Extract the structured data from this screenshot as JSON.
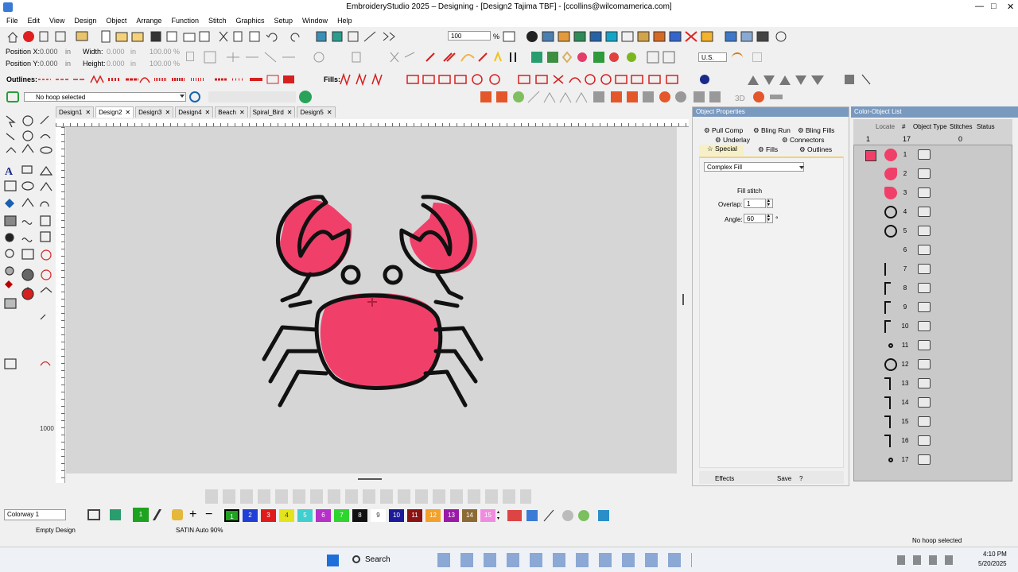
{
  "window": {
    "title": "EmbroideryStudio 2025 – Designing - [Design2     Tajima TBF] - [ccollins@wilcomamerica.com]",
    "min": "—",
    "max": "□",
    "close": "✕"
  },
  "menu": [
    "File",
    "Edit",
    "View",
    "Design",
    "Object",
    "Arrange",
    "Function",
    "Stitch",
    "Graphics",
    "Setup",
    "Window",
    "Help"
  ],
  "zoom": {
    "value": "100",
    "unit": "%"
  },
  "position": {
    "x_label": "Position X:",
    "x_value": "0.000",
    "y_label": "Position Y:",
    "y_value": "0.000",
    "unit": "in",
    "w_label": "Width:",
    "w_value": "0.000",
    "h_label": "Height:",
    "h_value": "0.000",
    "w_pct": "100.00",
    "h_pct": "100.00",
    "pct": "%"
  },
  "units": "U.S.",
  "outlines_label": "Outlines:",
  "fills_label": "Fills:",
  "hoop": "No hoop selected",
  "tabs": [
    "Design1",
    "Design2",
    "Design3",
    "Design4",
    "Beach",
    "Spiral_Bird",
    "Design5"
  ],
  "object_properties": {
    "title": "Object Properties",
    "tabs_row1": [
      "Pull Comp",
      "Bling Run",
      "Bling Fills"
    ],
    "tabs_row2": [
      "Underlay",
      "Connectors"
    ],
    "tabs_row3": [
      "Special",
      "Fills",
      "Outlines"
    ],
    "fill_type": "Complex Fill",
    "section": "Fill stitch",
    "overlap_label": "Overlap:",
    "overlap": "1",
    "angle_label": "Angle:",
    "angle": "60",
    "angle_unit": "°",
    "effects": "Effects",
    "save": "Save",
    "help": "?"
  },
  "color_list": {
    "title": "Color-Object List",
    "headers": [
      "Locate",
      "#",
      "Object Type",
      "Stitches",
      "Status"
    ],
    "summary": {
      "first": "1",
      "count": "17",
      "stitches": "0"
    },
    "items": [
      "1",
      "2",
      "3",
      "4",
      "5",
      "6",
      "7",
      "8",
      "9",
      "10",
      "11",
      "12",
      "13",
      "14",
      "15",
      "16",
      "17"
    ]
  },
  "colorway": "Colorway 1",
  "palette": [
    {
      "n": "1",
      "c": "#1fa21f"
    },
    {
      "n": "2",
      "c": "#1f3fd6"
    },
    {
      "n": "3",
      "c": "#e01b1b"
    },
    {
      "n": "4",
      "c": "#e4e41b"
    },
    {
      "n": "5",
      "c": "#3fcfcf"
    },
    {
      "n": "6",
      "c": "#b630c9"
    },
    {
      "n": "7",
      "c": "#2fd42f"
    },
    {
      "n": "8",
      "c": "#111111"
    },
    {
      "n": "9",
      "c": "#ffffff"
    },
    {
      "n": "10",
      "c": "#1a1a9a"
    },
    {
      "n": "11",
      "c": "#8c1313"
    },
    {
      "n": "12",
      "c": "#f3a12b"
    },
    {
      "n": "13",
      "c": "#9a1aa8"
    },
    {
      "n": "14",
      "c": "#8d6a33"
    },
    {
      "n": "15",
      "c": "#f08ce0"
    }
  ],
  "status": {
    "left": "Empty Design",
    "mid": "SATIN Auto 90%",
    "right": "No hoop selected"
  },
  "taskbar": {
    "search": "Search",
    "time": "4:10 PM",
    "date": "5/20/2025"
  },
  "colors": {
    "crab": "#f0406a",
    "outline": "#111111",
    "canvas": "#d6d6d6"
  }
}
